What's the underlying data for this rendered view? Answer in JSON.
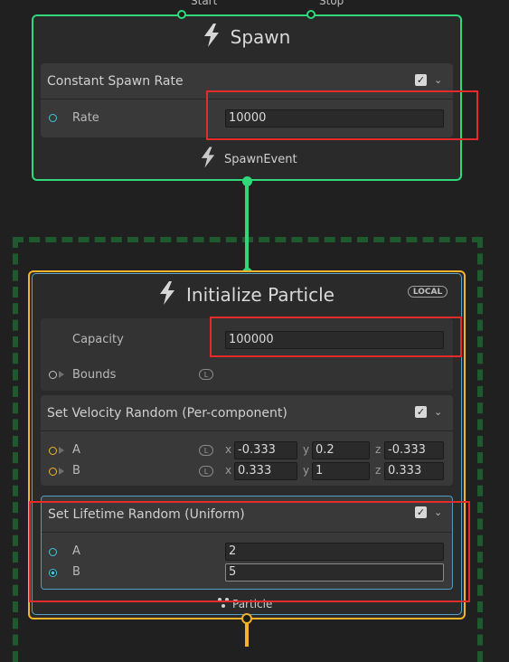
{
  "spawn_node": {
    "title": "Spawn",
    "input_ports": [
      "Start",
      "Stop"
    ],
    "block": {
      "title": "Constant Spawn Rate",
      "enabled": true,
      "rate_label": "Rate",
      "rate_value": "10000"
    },
    "output_label": "SpawnEvent"
  },
  "init_node": {
    "title": "Initialize Particle",
    "space_badge": "LOCAL",
    "capacity_label": "Capacity",
    "capacity_value": "100000",
    "bounds_label": "Bounds",
    "bounds_space": "L",
    "velocity_block": {
      "title": "Set Velocity Random (Per-component)",
      "enabled": true,
      "rows": [
        {
          "label": "A",
          "space": "L",
          "x": "-0.333",
          "y": "0.2",
          "z": "-0.333"
        },
        {
          "label": "B",
          "space": "L",
          "x": "0.333",
          "y": "1",
          "z": "0.333"
        }
      ],
      "axis_labels": [
        "x",
        "y",
        "z"
      ]
    },
    "lifetime_block": {
      "title": "Set Lifetime Random (Uniform)",
      "enabled": true,
      "rows": [
        {
          "label": "A",
          "value": "2"
        },
        {
          "label": "B",
          "value": "5"
        }
      ]
    },
    "output_label": "Particle"
  },
  "colors": {
    "flow_green": "#2fd97a",
    "particle_yellow": "#f2b32a",
    "highlight_red": "#e32b2b",
    "dashed_group": "#1f5a2f"
  },
  "icons": {
    "spawn_icon": "lightning-bolt",
    "output_icon": "lightning-bolt",
    "particle_icon": "particle-dots"
  }
}
